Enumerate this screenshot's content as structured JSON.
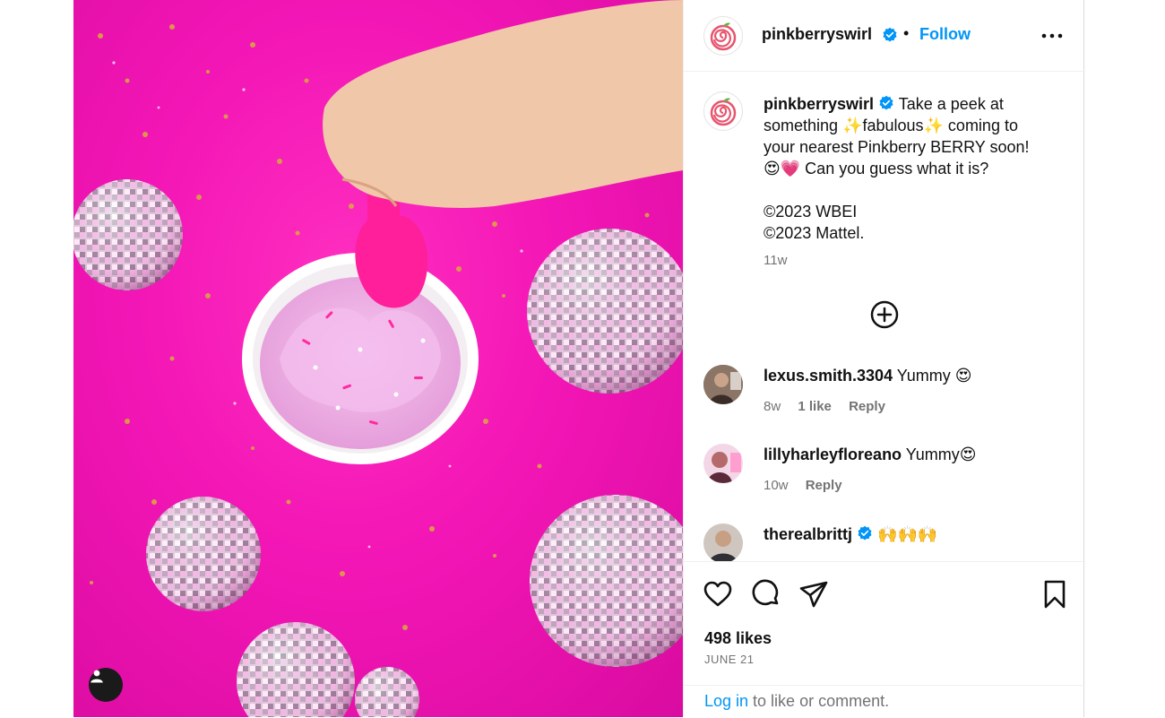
{
  "post": {
    "username": "pinkberryswirl",
    "follow_label": "Follow",
    "separator": "•",
    "caption": {
      "lines": [
        "Take a peek at",
        "something ✨fabulous✨ coming to",
        "your nearest Pinkberry BERRY soon!",
        "😍💗 Can you guess what it is?",
        "",
        "©2023 WBEI",
        "©2023 Mattel."
      ],
      "time": "11w"
    },
    "comments": [
      {
        "username": "lexus.smith.3304",
        "text": "Yummy 😍",
        "time": "8w",
        "likes": "1 like",
        "reply": "Reply",
        "verified": false
      },
      {
        "username": "lillyharleyfloreano",
        "text": "Yummy😍",
        "time": "10w",
        "reply": "Reply",
        "verified": false
      },
      {
        "username": "therealbrittj",
        "text": "🙌🙌🙌",
        "verified": true
      }
    ],
    "likes": "498 likes",
    "date": "JUNE 21",
    "login_link": "Log in",
    "login_text": " to like or comment."
  },
  "colors": {
    "brand_pink": "#f316b6",
    "link_blue": "#0095f6",
    "muted": "#737373",
    "verified_blue": "#0095f6"
  },
  "icons": {
    "header_more": "more-options-icon",
    "load_more": "plus-circle-icon",
    "like": "heart-icon",
    "comment": "comment-bubble-icon",
    "share": "paper-plane-icon",
    "save": "bookmark-icon",
    "tag": "user-tag-icon"
  }
}
